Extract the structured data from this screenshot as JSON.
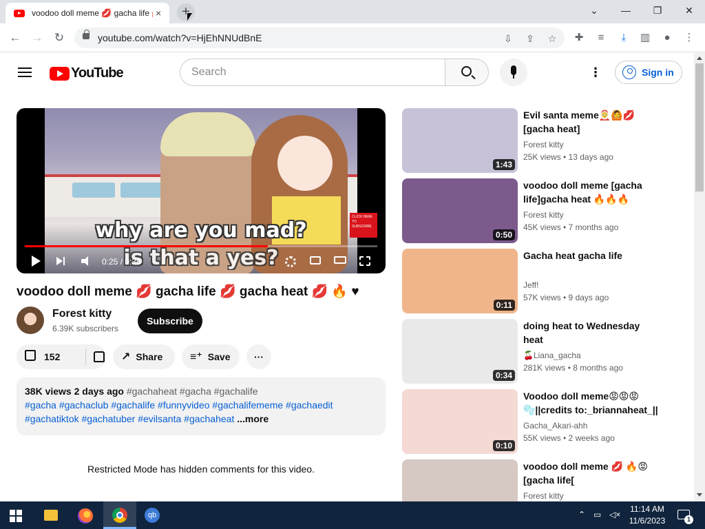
{
  "browser": {
    "tab_title": "voodoo doll meme 💋 gacha life 💋 gacha heat 💋 🔥 ♥ - YouTube",
    "tab_close": "×",
    "new_tab": "+",
    "url": "youtube.com/watch?v=HjEhNNUdBnE",
    "window_controls": {
      "minimize": "—",
      "restore": "❐",
      "close": "✕",
      "tab_search": "⌄"
    }
  },
  "youtube": {
    "logo_text": "YouTube",
    "search_placeholder": "Search",
    "signin_label": "Sign in",
    "more_label": "⋮"
  },
  "player": {
    "caption_line1": "why are you mad?",
    "caption_line2": "is that a yes?",
    "thumb_badge": "CLICK HERE TO SUBSCRIBE",
    "current_time": "0:25",
    "duration": "0:36",
    "timecode": "0:25 / 0:36",
    "progress": 0.69
  },
  "video": {
    "title": "voodoo doll meme 💋 gacha life 💋 gacha heat 💋 🔥 ♥",
    "channel": "Forest kitty",
    "subscribers": "6.39K subscribers",
    "subscribe_label": "Subscribe",
    "likes": "152",
    "share_label": "Share",
    "save_label": "Save",
    "more_actions": "···",
    "desc_meta": "38K views  2 days ago",
    "desc_meta_tags": " #gachaheat #gacha #gachalife",
    "desc_tags_line2": "#gacha #gachaclub #gachalife #funnyvideo #gachalifememe #gachaedit",
    "desc_tags_line3": "#gachatiktok #gachatuber #evilsanta #gachaheat",
    "desc_more": " ...more",
    "restricted_notice": "Restricted Mode has hidden comments for this video."
  },
  "recommendations": [
    {
      "title": "Evil santa meme🤶🙆💋 [gacha heat]",
      "channel": "Forest kitty",
      "meta": "25K views • 13 days ago",
      "duration": "1:43",
      "thumb_color": "#c8c2d8"
    },
    {
      "title": "voodoo doll meme [gacha life]gacha heat 🔥🔥🔥",
      "channel": "Forest kitty",
      "meta": "45K views • 7 months ago",
      "duration": "0:50",
      "thumb_color": "#7d5a8c"
    },
    {
      "title": "Gacha heat gacha life",
      "channel": "Jeff!",
      "meta": "57K views • 9 days ago",
      "duration": "0:11",
      "thumb_color": "#f0b58a"
    },
    {
      "title": "doing heat to Wednesday heat",
      "channel": "🍒Liana_gacha",
      "meta": "281K views • 8 months ago",
      "duration": "0:34",
      "thumb_color": "#e9e9e9"
    },
    {
      "title": "Voodoo doll meme😡😡😡 🫧||credits to:_briannaheat_||",
      "channel": "Gacha_Akari-ahh",
      "meta": "55K views • 2 weeks ago",
      "duration": "0:10",
      "thumb_color": "#f4d9d4"
    },
    {
      "title": "voodoo doll meme 💋 🔥😡 [gacha life[",
      "channel": "Forest kitty",
      "meta": "",
      "duration": "",
      "thumb_color": "#d6c8c2"
    }
  ],
  "taskbar": {
    "qb_label": "qb",
    "clock_time": "11:14 AM",
    "clock_date": "11/6/2023",
    "notification_count": "1"
  }
}
